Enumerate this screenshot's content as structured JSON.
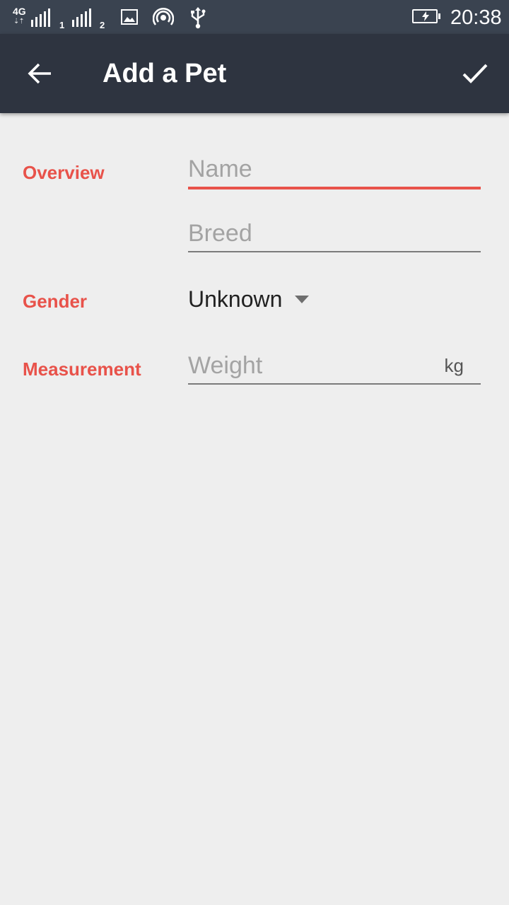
{
  "status_bar": {
    "network_type": "4G",
    "sim1_label": "1",
    "sim2_label": "2",
    "time": "20:38",
    "icons": [
      "signal-icon",
      "image-icon",
      "hotspot-icon",
      "usb-icon",
      "battery-charging-icon"
    ]
  },
  "app_bar": {
    "title": "Add a Pet",
    "back_icon": "arrow-back-icon",
    "confirm_icon": "check-icon"
  },
  "form": {
    "overview_label": "Overview",
    "name_placeholder": "Name",
    "name_value": "",
    "breed_placeholder": "Breed",
    "breed_value": "",
    "gender_label": "Gender",
    "gender_selected": "Unknown",
    "measurement_label": "Measurement",
    "weight_placeholder": "Weight",
    "weight_value": "",
    "weight_unit": "kg"
  },
  "colors": {
    "accent": "#e8524a",
    "app_bar": "#2e3440",
    "status_bar": "#3a4350",
    "background": "#eeeeee"
  }
}
